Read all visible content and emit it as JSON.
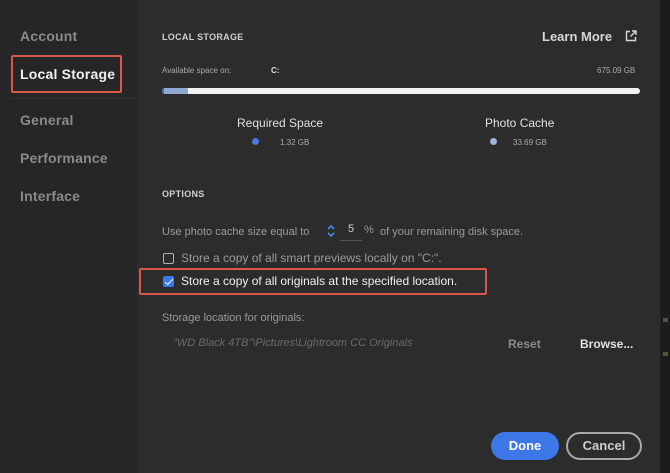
{
  "sidebar": {
    "items": [
      {
        "label": "Account"
      },
      {
        "label": "Local Storage"
      },
      {
        "label": "General"
      },
      {
        "label": "Performance"
      },
      {
        "label": "Interface"
      }
    ]
  },
  "local_storage": {
    "section_title": "LOCAL STORAGE",
    "learn_more": "Learn More",
    "available_label": "Available space on:",
    "drive": "C:",
    "total_space": "675.09 GB",
    "usage": {
      "required_fraction": 0.002,
      "cache_fraction": 0.05
    },
    "legend": [
      {
        "label": "Required Space",
        "value": "1.32 GB",
        "color": "#3f6fd6"
      },
      {
        "label": "Photo Cache",
        "value": "33.69 GB",
        "color": "#8fa8cf"
      }
    ]
  },
  "options": {
    "section_title": "OPTIONS",
    "cache_prefix": "Use photo cache size equal to",
    "cache_value": "5",
    "cache_unit": "%",
    "cache_suffix": "of your remaining disk space.",
    "smart_previews_label": "Store a copy of all smart previews locally on \"C:\".",
    "smart_previews_checked": false,
    "originals_label": "Store a copy of all originals at the specified location.",
    "originals_checked": true,
    "storage_location_label": "Storage location for originals:",
    "storage_path": "\"WD Black 4TB\"\\Pictures\\Lightroom CC Originals",
    "reset_label": "Reset",
    "browse_label": "Browse..."
  },
  "footer": {
    "done_label": "Done",
    "cancel_label": "Cancel"
  },
  "colors": {
    "accent": "#3e77e8",
    "highlight": "#d9584a"
  }
}
